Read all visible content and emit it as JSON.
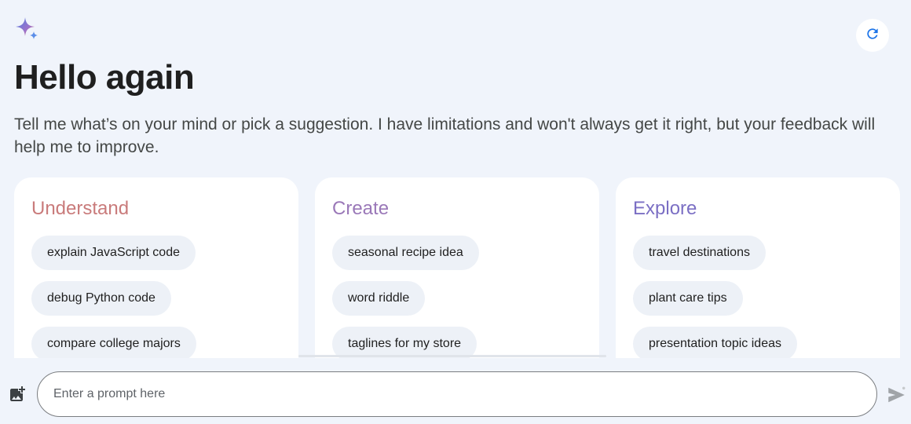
{
  "header": {
    "title": "Hello again",
    "subtitle": "Tell me what’s on your mind or pick a suggestion. I have limitations and won't always get it right, but your feedback will help me to improve."
  },
  "cards": [
    {
      "title": "Understand",
      "chips": [
        "explain JavaScript code",
        "debug Python code",
        "compare college majors"
      ]
    },
    {
      "title": "Create",
      "chips": [
        "seasonal recipe idea",
        "word riddle",
        "taglines for my store"
      ]
    },
    {
      "title": "Explore",
      "chips": [
        "travel destinations",
        "plant care tips",
        "presentation topic ideas"
      ]
    }
  ],
  "prompt": {
    "placeholder": "Enter a prompt here",
    "value": ""
  },
  "icons": {
    "logo": "sparkle-icon",
    "refresh": "refresh-icon",
    "upload": "add-image-icon",
    "send": "send-icon"
  },
  "colors": {
    "background": "#f0f4fb",
    "understand": "#c97b7b",
    "create": "#9a78b8",
    "explore": "#7b6fc4",
    "accent_blue": "#1a73e8"
  }
}
